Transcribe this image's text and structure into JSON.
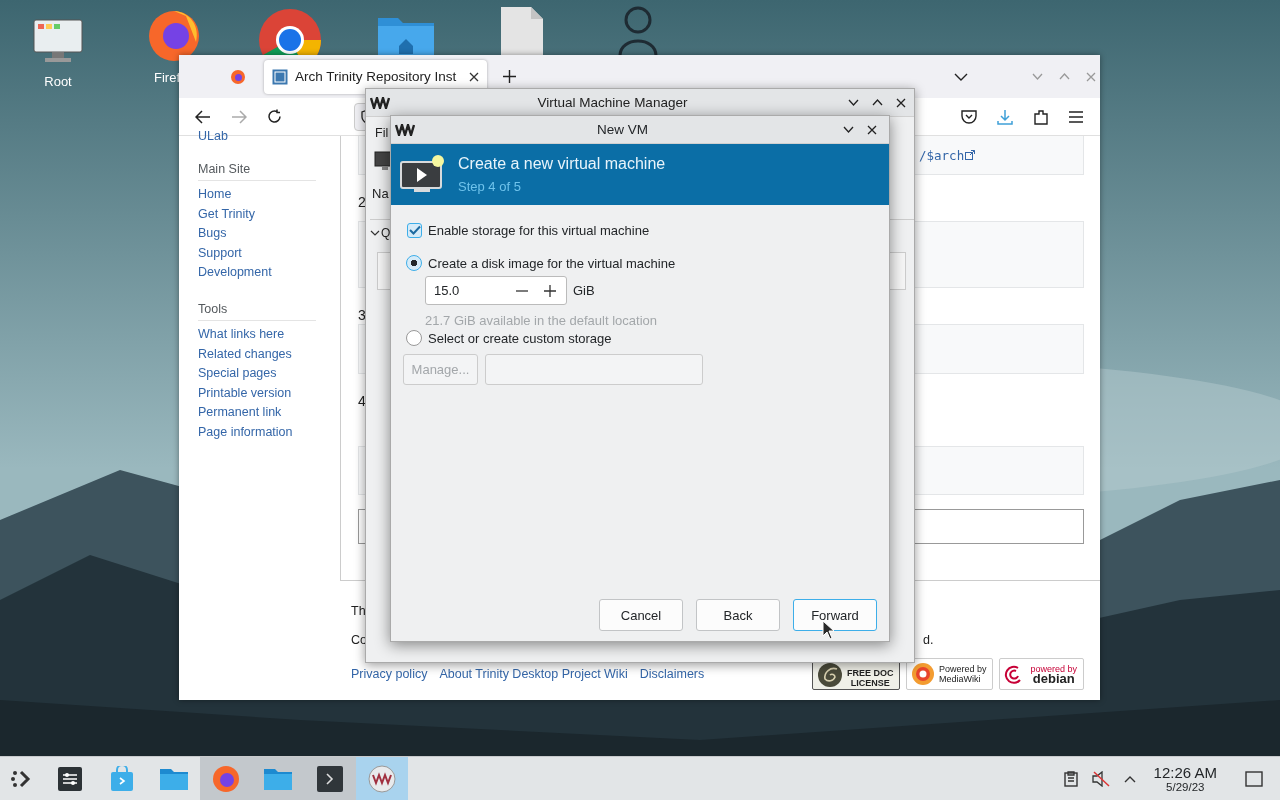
{
  "desktop_icons": [
    {
      "label": "Root"
    },
    {
      "label": "Firef"
    }
  ],
  "browser": {
    "tabs": [
      {
        "kind": "icon",
        "selected": false
      },
      {
        "kind": "page",
        "label": "Arch Trinity Repository Inst",
        "selected": true
      }
    ],
    "sidebar": {
      "top_link": "ULab",
      "sections": [
        {
          "heading": "Main Site",
          "links": [
            "Home",
            "Get Trinity",
            "Bugs",
            "Support",
            "Development"
          ]
        },
        {
          "heading": "Tools",
          "links": [
            "What links here",
            "Related changes",
            "Special pages",
            "Printable version",
            "Permanent link",
            "Page information"
          ]
        }
      ]
    },
    "content": {
      "code_link": "/$arch",
      "step_numbers": [
        "2",
        "3",
        "4"
      ],
      "footer_texts": [
        "Th",
        "Co",
        "d."
      ],
      "footer_links": [
        "Privacy policy",
        "About Trinity Desktop Project Wiki",
        "Disclaimers"
      ],
      "badges": [
        {
          "kind": "gfdl",
          "lines": [
            "FREE DOC",
            "LICENSE"
          ]
        },
        {
          "kind": "mediawiki",
          "lines": [
            "Powered by",
            "MediaWiki"
          ]
        },
        {
          "kind": "debian",
          "lines": [
            "powered by",
            "debian"
          ]
        }
      ]
    }
  },
  "vmm": {
    "title": "Virtual Machine Manager",
    "menu": "Fil",
    "column": "Na",
    "group": "Q"
  },
  "dialog": {
    "title": "New VM",
    "heading": "Create a new virtual machine",
    "step": "Step 4 of 5",
    "options": [
      {
        "kind": "checkbox",
        "label": "Enable storage for this virtual machine",
        "checked": true
      },
      {
        "kind": "radio",
        "label": "Create a disk image for the virtual machine",
        "selected": true
      },
      {
        "kind": "radio",
        "label": "Select or create custom storage",
        "selected": false
      }
    ],
    "size": {
      "value": "15.0",
      "unit": "GiB",
      "hint": "21.7 GiB available in the default location"
    },
    "manage": {
      "label": "Manage...",
      "disabled": true
    },
    "buttons": [
      {
        "label": "Cancel",
        "focused": false
      },
      {
        "label": "Back",
        "focused": false
      },
      {
        "label": "Forward",
        "focused": true
      }
    ]
  },
  "taskbar": {
    "tasks": [
      {
        "open": false,
        "selected": false
      },
      {
        "open": false,
        "selected": false
      },
      {
        "open": false,
        "selected": false
      },
      {
        "open": false,
        "selected": false
      },
      {
        "open": true,
        "selected": false
      },
      {
        "open": true,
        "selected": false
      },
      {
        "open": true,
        "selected": false
      },
      {
        "open": true,
        "selected": true
      }
    ],
    "time": "12:26 AM",
    "date": "5/29/23"
  }
}
